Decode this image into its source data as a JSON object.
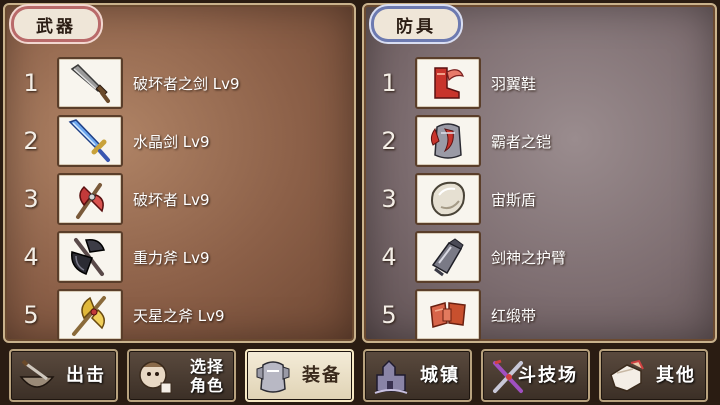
{
  "weapons": {
    "tab_label": "武器",
    "items": [
      {
        "rank": "1",
        "name": "破坏者之剑 Lv9",
        "icon": "broad-sword-icon"
      },
      {
        "rank": "2",
        "name": "水晶剑 Lv9",
        "icon": "crystal-sword-icon"
      },
      {
        "rank": "3",
        "name": "破坏者 Lv9",
        "icon": "red-axe-icon"
      },
      {
        "rank": "4",
        "name": "重力斧 Lv9",
        "icon": "dark-axe-icon"
      },
      {
        "rank": "5",
        "name": "天星之斧 Lv9",
        "icon": "golden-axe-icon"
      }
    ]
  },
  "armor": {
    "tab_label": "防具",
    "items": [
      {
        "rank": "1",
        "name": "羽翼鞋",
        "icon": "winged-boots-icon"
      },
      {
        "rank": "2",
        "name": "霸者之铠",
        "icon": "armor-icon"
      },
      {
        "rank": "3",
        "name": "宙斯盾",
        "icon": "shield-icon"
      },
      {
        "rank": "4",
        "name": "剑神之护臂",
        "icon": "gauntlet-icon"
      },
      {
        "rank": "5",
        "name": "红缎带",
        "icon": "red-ribbon-icon"
      }
    ]
  },
  "nav": {
    "sortie": "出击",
    "select_line1": "选择",
    "select_line2": "角色",
    "equip": "装备",
    "town": "城镇",
    "arena": "斗技场",
    "other": "其他"
  },
  "colors": {
    "weapons_tab_border": "#b96a6a",
    "armor_tab_border": "#6d7ab0",
    "active_button": "#f4ecd8"
  }
}
